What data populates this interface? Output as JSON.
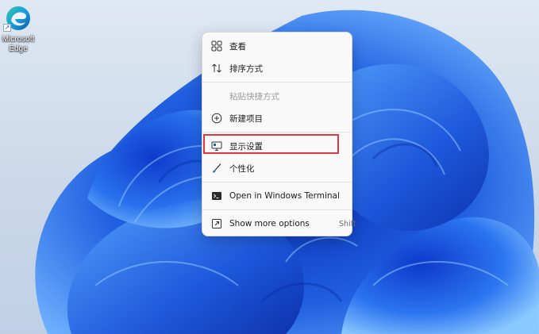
{
  "desktop": {
    "icons": [
      {
        "label": "Microsoft Edge",
        "icon": "edge-icon"
      }
    ]
  },
  "context_menu": {
    "items": [
      {
        "label": "查看",
        "icon": "grid-view-icon",
        "disabled": false
      },
      {
        "label": "排序方式",
        "icon": "sort-arrows-icon",
        "disabled": false
      },
      {
        "label": "粘贴快捷方式",
        "icon": "",
        "disabled": true
      },
      {
        "label": "新建项目",
        "icon": "plus-circle-icon",
        "disabled": false
      },
      {
        "label": "显示设置",
        "icon": "display-settings-icon",
        "disabled": false,
        "highlighted": true
      },
      {
        "label": "个性化",
        "icon": "brush-icon",
        "disabled": false
      },
      {
        "label": "Open in Windows Terminal",
        "icon": "terminal-icon",
        "disabled": false
      },
      {
        "label": "Show more options",
        "icon": "more-options-icon",
        "disabled": false,
        "shortcut": "Shift"
      }
    ]
  },
  "colors": {
    "highlight_border": "#e0383e",
    "wallpaper_blue": "#1f5fe0",
    "icon_blue": "#0a66c2"
  }
}
